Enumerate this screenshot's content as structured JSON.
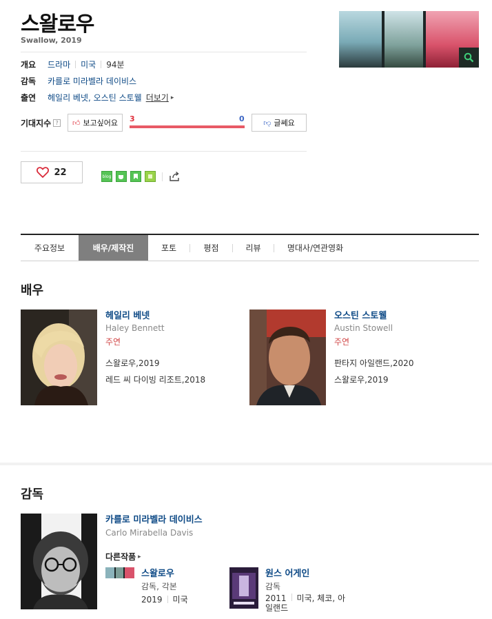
{
  "movie": {
    "title": "스왈로우",
    "subtitle": "Swallow, 2019",
    "overview_label": "개요",
    "genre": "드라마",
    "country": "미국",
    "runtime": "94분",
    "director_label": "감독",
    "director": "카를로 미라벨라 데이비스",
    "cast_label": "출연",
    "cast": "헤일리 베넷, 오스틴 스토웰",
    "more": "더보기"
  },
  "expectation": {
    "label": "기대지수",
    "help": "?",
    "want_label": "보고싶어요",
    "want_count": "3",
    "not_want_count": "0",
    "not_want_label": "글쎄요",
    "want_ratio": 1.0
  },
  "like": {
    "count": "22"
  },
  "share": {
    "blog_label": "blog"
  },
  "tabs": [
    "주요정보",
    "배우/제작진",
    "포토",
    "평점",
    "리뷰",
    "명대사/연관영화"
  ],
  "actors_section": {
    "heading": "배우",
    "actors": [
      {
        "name_kr": "헤일리 베넷",
        "name_en": "Haley Bennett",
        "role": "주연",
        "works": [
          "스왈로우,2019",
          "레드 씨 다이빙 리조트,2018"
        ]
      },
      {
        "name_kr": "오스틴 스토웰",
        "name_en": "Austin Stowell",
        "role": "주연",
        "works": [
          "판타지 아일랜드,2020",
          "스왈로우,2019"
        ]
      }
    ]
  },
  "director_section": {
    "heading": "감독",
    "name_kr": "카를로 미라벨라 데이비스",
    "name_en": "Carlo Mirabella Davis",
    "other_works_label": "다른작품",
    "works": [
      {
        "title": "스왈로우",
        "role": "감독, 각본",
        "year": "2019",
        "country": "미국"
      },
      {
        "title": "원스 어게인",
        "role": "감독",
        "year": "2011",
        "country": "미국, 체코, 아일랜드"
      }
    ]
  },
  "colors": {
    "link": "#0e4a86",
    "accent_red": "#e85a66",
    "accent_blue": "#3c66c4",
    "tab_active": "#7f7f7f"
  }
}
